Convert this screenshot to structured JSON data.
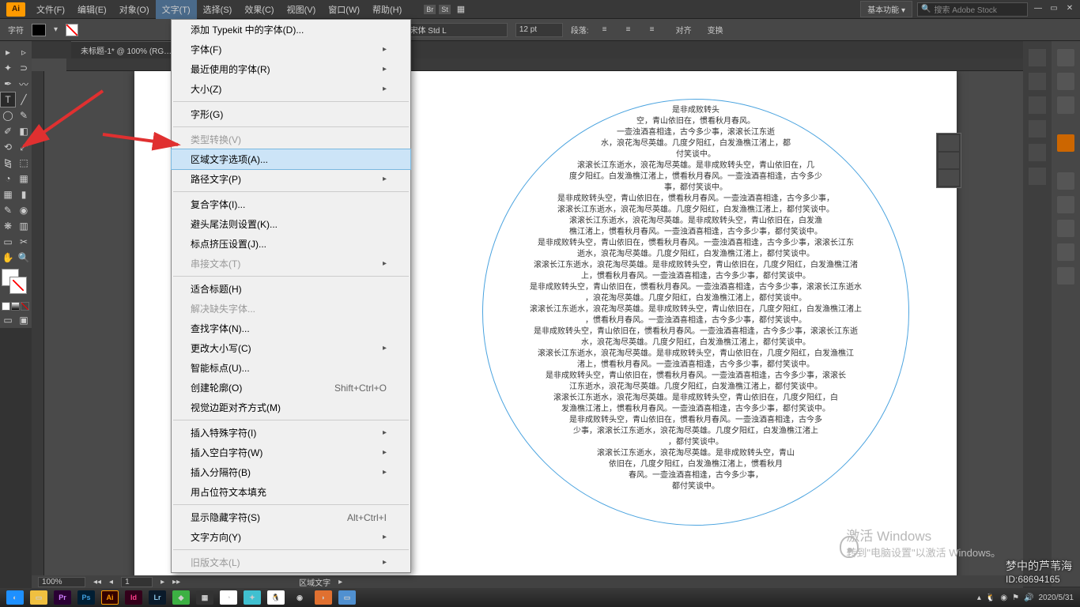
{
  "app": {
    "logo": "Ai"
  },
  "menubar": {
    "items": [
      "文件(F)",
      "编辑(E)",
      "对象(O)",
      "文字(T)",
      "选择(S)",
      "效果(C)",
      "视图(V)",
      "窗口(W)",
      "帮助(H)"
    ],
    "active_index": 3,
    "workspace_label": "基本功能",
    "search_placeholder": "搜索 Adobe Stock"
  },
  "optionbar": {
    "label": "字符",
    "font_label": "字符:",
    "font_value": "Adobe 宋体 Std L",
    "size_value": "12 pt",
    "para_label": "段落:",
    "align_label": "对齐",
    "transform_label": "变换"
  },
  "doctab": {
    "title": "未标题-1* @ 100% (RG…"
  },
  "dropdown": {
    "items": [
      {
        "label": "添加 Typekit 中的字体(D)...",
        "type": "item"
      },
      {
        "label": "字体(F)",
        "type": "sub"
      },
      {
        "label": "最近使用的字体(R)",
        "type": "sub"
      },
      {
        "label": "大小(Z)",
        "type": "sub"
      },
      {
        "type": "sep"
      },
      {
        "label": "字形(G)",
        "type": "item"
      },
      {
        "type": "sep"
      },
      {
        "label": "类型转换(V)",
        "type": "item",
        "disabled": true
      },
      {
        "label": "区域文字选项(A)...",
        "type": "item",
        "highlight": true
      },
      {
        "label": "路径文字(P)",
        "type": "sub"
      },
      {
        "type": "sep"
      },
      {
        "label": "复合字体(I)...",
        "type": "item"
      },
      {
        "label": "避头尾法则设置(K)...",
        "type": "item"
      },
      {
        "label": "标点挤压设置(J)...",
        "type": "item"
      },
      {
        "label": "串接文本(T)",
        "type": "sub",
        "disabled": true
      },
      {
        "type": "sep"
      },
      {
        "label": "适合标题(H)",
        "type": "item"
      },
      {
        "label": "解决缺失字体...",
        "type": "item",
        "disabled": true
      },
      {
        "label": "查找字体(N)...",
        "type": "item"
      },
      {
        "label": "更改大小写(C)",
        "type": "sub"
      },
      {
        "label": "智能标点(U)...",
        "type": "item"
      },
      {
        "label": "创建轮廓(O)",
        "shortcut": "Shift+Ctrl+O",
        "type": "item"
      },
      {
        "label": "视觉边距对齐方式(M)",
        "type": "item"
      },
      {
        "type": "sep"
      },
      {
        "label": "插入特殊字符(I)",
        "type": "sub"
      },
      {
        "label": "插入空白字符(W)",
        "type": "sub"
      },
      {
        "label": "插入分隔符(B)",
        "type": "sub"
      },
      {
        "label": "用占位符文本填充",
        "type": "item"
      },
      {
        "type": "sep"
      },
      {
        "label": "显示隐藏字符(S)",
        "shortcut": "Alt+Ctrl+I",
        "type": "item"
      },
      {
        "label": "文字方向(Y)",
        "type": "sub"
      },
      {
        "type": "sep"
      },
      {
        "label": "旧版文本(L)",
        "type": "sub",
        "disabled": true
      }
    ]
  },
  "circle_text": [
    "是非成败转头",
    "空，青山依旧在，惯看秋月春风。",
    "一壶浊酒喜相逢，古今多少事，滚滚长江东逝",
    "水，浪花淘尽英雄。几度夕阳红，白发渔樵江渚上，都",
    "付笑谈中。",
    "滚滚长江东逝水，浪花淘尽英雄。是非成败转头空，青山依旧在，几",
    "度夕阳红。白发渔樵江渚上，惯看秋月春风。一壶浊酒喜相逢，古今多少",
    "事，都付笑谈中。",
    "是非成败转头空，青山依旧在，惯看秋月春风。一壶浊酒喜相逢，古今多少事，",
    "滚滚长江东逝水，浪花淘尽英雄。几度夕阳红，白发渔樵江渚上，都付笑谈中。",
    "滚滚长江东逝水，浪花淘尽英雄。是非成败转头空，青山依旧在，白发渔",
    "樵江渚上，惯看秋月春风。一壶浊酒喜相逢，古今多少事，都付笑谈中。",
    "是非成败转头空，青山依旧在，惯看秋月春风。一壶浊酒喜相逢，古今多少事，滚滚长江东",
    "逝水，浪花淘尽英雄。几度夕阳红，白发渔樵江渚上，都付笑谈中。",
    "滚滚长江东逝水，浪花淘尽英雄。是非成败转头空，青山依旧在，几度夕阳红，白发渔樵江渚",
    "上，惯看秋月春风。一壶浊酒喜相逢，古今多少事，都付笑谈中。",
    "是非成败转头空，青山依旧在，惯看秋月春风。一壶浊酒喜相逢，古今多少事，滚滚长江东逝水",
    "，浪花淘尽英雄。几度夕阳红，白发渔樵江渚上，都付笑谈中。",
    "滚滚长江东逝水，浪花淘尽英雄。是非成败转头空，青山依旧在，几度夕阳红，白发渔樵江渚上",
    "，惯看秋月春风。一壶浊酒喜相逢，古今多少事，都付笑谈中。",
    "是非成败转头空，青山依旧在，惯看秋月春风。一壶浊酒喜相逢，古今多少事，滚滚长江东逝",
    "水，浪花淘尽英雄。几度夕阳红，白发渔樵江渚上，都付笑谈中。",
    "滚滚长江东逝水，浪花淘尽英雄。是非成败转头空，青山依旧在，几度夕阳红，白发渔樵江",
    "渚上，惯看秋月春风。一壶浊酒喜相逢，古今多少事，都付笑谈中。",
    "是非成败转头空，青山依旧在，惯看秋月春风。一壶浊酒喜相逢，古今多少事，滚滚长",
    "江东逝水，浪花淘尽英雄。几度夕阳红，白发渔樵江渚上，都付笑谈中。",
    "滚滚长江东逝水，浪花淘尽英雄。是非成败转头空，青山依旧在，几度夕阳红，白",
    "发渔樵江渚上，惯看秋月春风。一壶浊酒喜相逢，古今多少事，都付笑谈中。",
    "是非成败转头空，青山依旧在，惯看秋月春风。一壶浊酒喜相逢，古今多",
    "少事，滚滚长江东逝水，浪花淘尽英雄。几度夕阳红，白发渔樵江渚上",
    "，都付笑谈中。",
    "滚滚长江东逝水，浪花淘尽英雄。是非成败转头空，青山",
    "依旧在，几度夕阳红，白发渔樵江渚上，惯看秋月",
    "春风。一壶浊酒喜相逢，古今多少事，",
    "都付笑谈中。"
  ],
  "statusbar": {
    "zoom": "100%",
    "nav": "1",
    "mode": "区域文字"
  },
  "watermark": {
    "activate_title": "激活 Windows",
    "activate_sub": "转到\"电脑设置\"以激活 Windows。",
    "author": "梦中的芦苇海",
    "id": "ID:68694165"
  },
  "taskbar": {
    "date": "2020/5/31"
  }
}
